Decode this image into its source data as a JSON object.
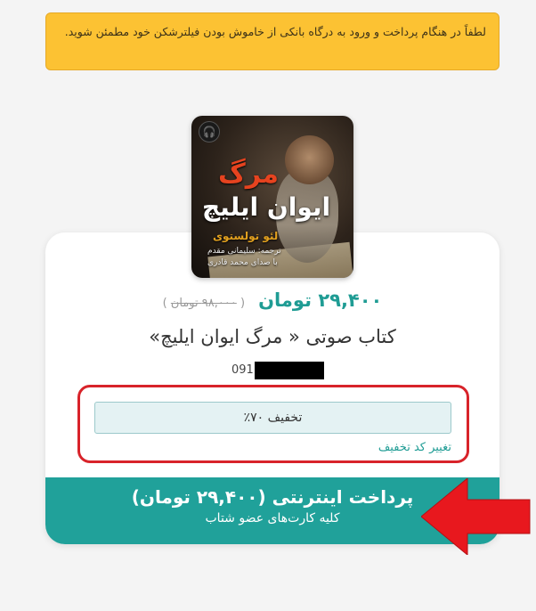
{
  "alert": {
    "text": "لطفاً در هنگام پرداخت و ورود به درگاه بانکی از خاموش بودن فیلترشکن خود مطمئن شوید."
  },
  "cover": {
    "title_top": "مرگ",
    "title_main": "ایوان ایلیچ",
    "author": "لئو تولستوی",
    "credit1": "ترجمه: سلیمانی مقدم",
    "credit2": "با صدای محمد قادری"
  },
  "product": {
    "price_now": "۲۹,۴۰۰ تومان",
    "price_old": "۹۸,۰۰۰ تومان",
    "title": "کتاب صوتی « مرگ ایوان ایلیچ»",
    "phone_prefix": "091"
  },
  "discount": {
    "label": "تخفیف ۷۰٪",
    "change_link": "تغییر کد تخفیف"
  },
  "pay": {
    "title": "پرداخت اینترنتی (۲۹,۴۰۰ تومان)",
    "subtitle": "کلیه کارت‌های عضو شتاب"
  },
  "colors": {
    "accent": "#20a19a",
    "alert_bg": "#fcc233",
    "annotation_red": "#d8232a"
  },
  "icons": {
    "cover_badge": "headphones-icon",
    "annotation": "red-arrow-icon"
  }
}
